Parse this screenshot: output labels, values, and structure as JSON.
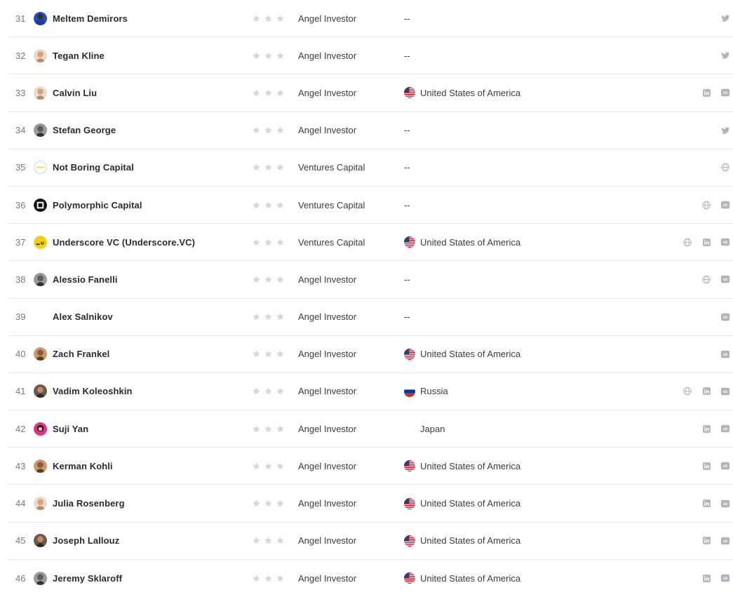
{
  "colors": {
    "star": "#d6d6db",
    "icon": "#b3b3bb",
    "divider": "#e8e8ea"
  },
  "rows": [
    {
      "rank": "31",
      "name": "Meltem Demirors",
      "avatar": "photo-blue",
      "type": "Angel Investor",
      "flag": "",
      "location": "--",
      "socials": [
        "twitter"
      ]
    },
    {
      "rank": "32",
      "name": "Tegan Kline",
      "avatar": "photo-light",
      "type": "Angel Investor",
      "flag": "",
      "location": "--",
      "socials": [
        "twitter"
      ]
    },
    {
      "rank": "33",
      "name": "Calvin Liu",
      "avatar": "photo-light",
      "type": "Angel Investor",
      "flag": "us",
      "location": "United States of America",
      "socials": [
        "linkedin",
        "crunchbase"
      ]
    },
    {
      "rank": "34",
      "name": "Stefan George",
      "avatar": "photo-gray",
      "type": "Angel Investor",
      "flag": "",
      "location": "--",
      "socials": [
        "twitter"
      ]
    },
    {
      "rank": "35",
      "name": "Not Boring Capital",
      "avatar": "logo-notboring",
      "type": "Ventures Capital",
      "flag": "",
      "location": "--",
      "socials": [
        "website"
      ]
    },
    {
      "rank": "36",
      "name": "Polymorphic Capital",
      "avatar": "logo-polymorphic",
      "type": "Ventures Capital",
      "flag": "",
      "location": "--",
      "socials": [
        "website",
        "crunchbase"
      ]
    },
    {
      "rank": "37",
      "name": "Underscore VC (Underscore.VC)",
      "avatar": "logo-underscore",
      "type": "Ventures Capital",
      "flag": "us",
      "location": "United States of America",
      "socials": [
        "website",
        "linkedin",
        "crunchbase"
      ]
    },
    {
      "rank": "38",
      "name": "Alessio Fanelli",
      "avatar": "photo-gray",
      "type": "Angel Investor",
      "flag": "",
      "location": "--",
      "socials": [
        "website",
        "crunchbase"
      ]
    },
    {
      "rank": "39",
      "name": "Alex Salnikov",
      "avatar": "",
      "type": "Angel Investor",
      "flag": "",
      "location": "--",
      "socials": [
        "crunchbase"
      ]
    },
    {
      "rank": "40",
      "name": "Zach Frankel",
      "avatar": "photo-warm",
      "type": "Angel Investor",
      "flag": "us",
      "location": "United States of America",
      "socials": [
        "crunchbase"
      ]
    },
    {
      "rank": "41",
      "name": "Vadim Koleoshkin",
      "avatar": "photo-dark",
      "type": "Angel Investor",
      "flag": "ru",
      "location": "Russia",
      "socials": [
        "website",
        "linkedin",
        "crunchbase"
      ]
    },
    {
      "rank": "42",
      "name": "Suji Yan",
      "avatar": "photo-pink",
      "type": "Angel Investor",
      "flag": "none",
      "location": "Japan",
      "socials": [
        "linkedin",
        "crunchbase"
      ]
    },
    {
      "rank": "43",
      "name": "Kerman Kohli",
      "avatar": "photo-warm",
      "type": "Angel Investor",
      "flag": "us",
      "location": "United States of America",
      "socials": [
        "linkedin",
        "crunchbase"
      ]
    },
    {
      "rank": "44",
      "name": "Julia Rosenberg",
      "avatar": "photo-light",
      "type": "Angel Investor",
      "flag": "us",
      "location": "United States of America",
      "socials": [
        "linkedin",
        "crunchbase"
      ]
    },
    {
      "rank": "45",
      "name": "Joseph Lallouz",
      "avatar": "photo-dark",
      "type": "Angel Investor",
      "flag": "us",
      "location": "United States of America",
      "socials": [
        "linkedin",
        "crunchbase"
      ]
    },
    {
      "rank": "46",
      "name": "Jeremy Sklaroff",
      "avatar": "photo-gray",
      "type": "Angel Investor",
      "flag": "us",
      "location": "United States of America",
      "socials": [
        "linkedin",
        "crunchbase"
      ]
    }
  ]
}
